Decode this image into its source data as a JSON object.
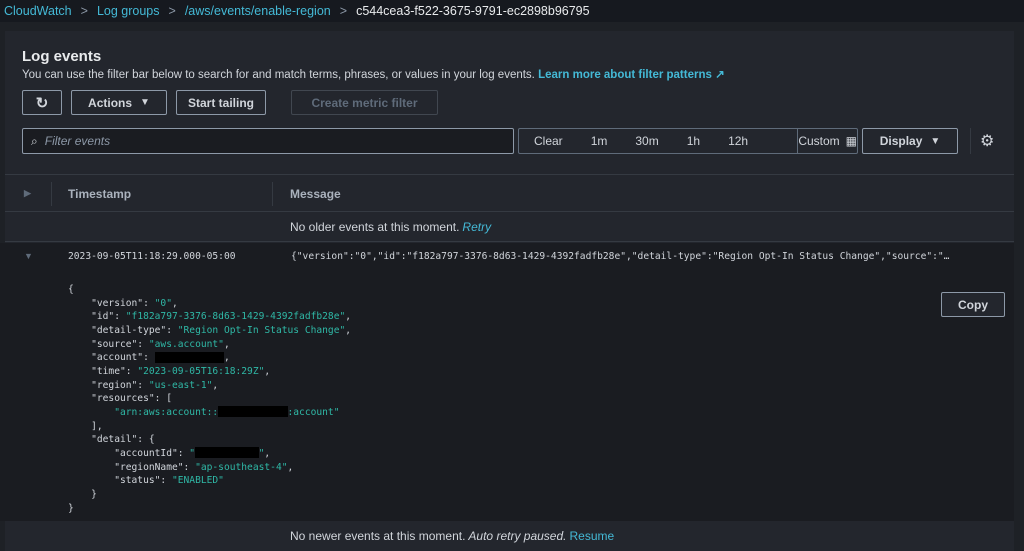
{
  "breadcrumb": [
    "CloudWatch",
    "Log groups",
    "/aws/events/enable-region",
    "c544cea3-f522-3675-9791-ec2898b96795"
  ],
  "header": {
    "title": "Log events",
    "description": "You can use the filter bar below to search for and match terms, phrases, or values in your log events.",
    "learn_more": "Learn more about filter patterns"
  },
  "toolbar": {
    "actions": "Actions",
    "start_tailing": "Start tailing",
    "create_metric_filter": "Create metric filter"
  },
  "filter": {
    "placeholder": "Filter events",
    "ranges": [
      "Clear",
      "1m",
      "30m",
      "1h",
      "12h"
    ],
    "custom": "Custom",
    "display": "Display"
  },
  "table": {
    "columns": [
      "Timestamp",
      "Message"
    ],
    "older_text": "No older events at this moment.",
    "retry": "Retry",
    "newer_text": "No newer events at this moment.",
    "auto_retry": "Auto retry paused.",
    "resume": "Resume"
  },
  "event": {
    "timestamp": "2023-09-05T11:18:29.000-05:00",
    "message": "{\"version\":\"0\",\"id\":\"f182a797-3376-8d63-1429-4392fadfb28e\",\"detail-type\":\"Region Opt-In Status Change\",\"source\":\"…",
    "copy": "Copy",
    "json_lines": [
      [
        [
          "{",
          "k"
        ]
      ],
      [
        [
          "    \"version\": ",
          "k"
        ],
        [
          "\"0\"",
          "v"
        ],
        [
          ",",
          "k"
        ]
      ],
      [
        [
          "    \"id\": ",
          "k"
        ],
        [
          "\"f182a797-3376-8d63-1429-4392fadfb28e\"",
          "v"
        ],
        [
          ",",
          "k"
        ]
      ],
      [
        [
          "    \"detail-type\": ",
          "k"
        ],
        [
          "\"Region Opt-In Status Change\"",
          "v"
        ],
        [
          ",",
          "k"
        ]
      ],
      [
        [
          "    \"source\": ",
          "k"
        ],
        [
          "\"aws.account\"",
          "v"
        ],
        [
          ",",
          "k"
        ]
      ],
      [
        [
          "    \"account\": ",
          "k"
        ],
        [
          "            ",
          "r"
        ],
        [
          ",",
          "k"
        ]
      ],
      [
        [
          "    \"time\": ",
          "k"
        ],
        [
          "\"2023-09-05T16:18:29Z\"",
          "v"
        ],
        [
          ",",
          "k"
        ]
      ],
      [
        [
          "    \"region\": ",
          "k"
        ],
        [
          "\"us-east-1\"",
          "v"
        ],
        [
          ",",
          "k"
        ]
      ],
      [
        [
          "    \"resources\": [",
          "k"
        ]
      ],
      [
        [
          "        \"arn:aws:account::",
          "v"
        ],
        [
          "            ",
          "r"
        ],
        [
          ":account\"",
          "v"
        ]
      ],
      [
        [
          "    ],",
          "k"
        ]
      ],
      [
        [
          "    \"detail\": {",
          "k"
        ]
      ],
      [
        [
          "        \"accountId\": ",
          "k"
        ],
        [
          "\"",
          "v"
        ],
        [
          "           ",
          "r"
        ],
        [
          "\"",
          "v"
        ],
        [
          ",",
          "k"
        ]
      ],
      [
        [
          "        \"regionName\": ",
          "k"
        ],
        [
          "\"ap-southeast-4\"",
          "v"
        ],
        [
          ",",
          "k"
        ]
      ],
      [
        [
          "        \"status\": ",
          "k"
        ],
        [
          "\"ENABLED\"",
          "v"
        ]
      ],
      [
        [
          "    }",
          "k"
        ]
      ],
      [
        [
          "}",
          "k"
        ]
      ]
    ]
  }
}
